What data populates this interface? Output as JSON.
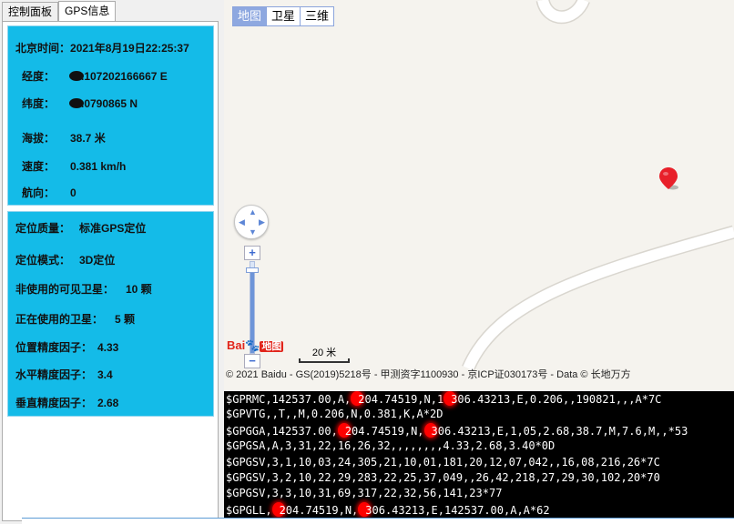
{
  "tabs": [
    {
      "label": "控制面板",
      "active": false
    },
    {
      "label": "GPS信息",
      "active": true
    }
  ],
  "info_top": {
    "time_label": "北京时间：",
    "time_value": "2021年8月19日22:25:37",
    "longitude_label": "经度：",
    "longitude_value": ".107202166667 E",
    "latitude_label": "纬度：",
    "latitude_value": ".0790865 N",
    "altitude_label": "海拔：",
    "altitude_value": "38.7 米",
    "speed_label": "速度：",
    "speed_value": "0.381 km/h",
    "heading_label": "航向：",
    "heading_value": "0"
  },
  "info_bottom": {
    "quality_label": "定位质量：",
    "quality_value": "标准GPS定位",
    "mode_label": "定位模式：",
    "mode_value": "3D定位",
    "unused_label": "非使用的可见卫星：",
    "unused_value": "10 颗",
    "used_label": "正在使用的卫星：",
    "used_value": "5 颗",
    "pdop_label": "位置精度因子：",
    "pdop_value": "4.33",
    "hdop_label": "水平精度因子：",
    "hdop_value": "3.4",
    "vdop_label": "垂直精度因子：",
    "vdop_value": "2.68"
  },
  "map": {
    "types": [
      {
        "label": "地图",
        "active": true
      },
      {
        "label": "卫星",
        "active": false
      },
      {
        "label": "三维",
        "active": false
      }
    ],
    "zoom_level_fraction": 0.9,
    "logo_bai": "Bai",
    "logo_ditu": "地图",
    "scale_label": "20 米",
    "copyright": "© 2021 Baidu - GS(2019)5218号 - 甲测资字1100930 - 京ICP证030173号 - Data © 长地万方",
    "pin_color": "#e8202a"
  },
  "nmea_lines": [
    {
      "a": "$GPRMC,142537.00,A,",
      "b": "204.74519,N,1",
      "c": "306.43213,E,0.206,,190821,,,A*7C"
    },
    {
      "a": "$GPVTG,,T,,M,0.206,N,0.381,K,A*2D"
    },
    {
      "a": "$GPGGA,142537.00,",
      "b": "204.74519,N,",
      "c": "306.43213,E,1,05,2.68,38.7,M,7.6,M,,*53"
    },
    {
      "a": "$GPGSA,A,3,31,22,16,26,32,,,,,,,,4.33,2.68,3.40*0D"
    },
    {
      "a": "$GPGSV,3,1,10,03,24,305,21,10,01,181,20,12,07,042,,16,08,216,26*7C"
    },
    {
      "a": "$GPGSV,3,2,10,22,29,283,22,25,37,049,,26,42,218,27,29,30,102,20*70"
    },
    {
      "a": "$GPGSV,3,3,10,31,69,317,22,32,56,141,23*77"
    },
    {
      "a": "$GPGLL,",
      "b": "204.74519,N,",
      "c": "306.43213,E,142537.00,A,A*62"
    }
  ],
  "colors": {
    "card_bg": "#14bbe8",
    "terminal_bg": "#000000",
    "redaction": "#ff0000"
  }
}
